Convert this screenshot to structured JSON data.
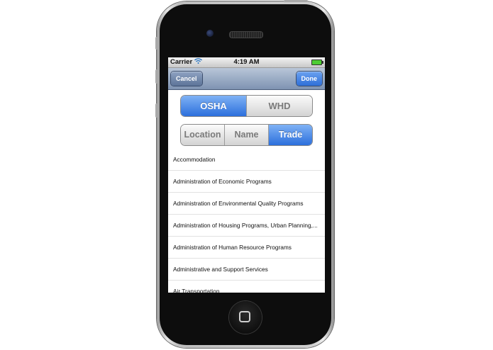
{
  "status_bar": {
    "carrier": "Carrier",
    "time": "4:19 AM"
  },
  "nav_bar": {
    "cancel_label": "Cancel",
    "done_label": "Done"
  },
  "agency_segment": {
    "options": [
      "OSHA",
      "WHD"
    ],
    "selected": "OSHA"
  },
  "search_segment": {
    "options": [
      "Location",
      "Name",
      "Trade"
    ],
    "selected": "Trade"
  },
  "trade_list": [
    "Accommodation",
    "Administration of Economic Programs",
    "Administration of Environmental Quality Programs",
    "Administration of Housing Programs, Urban Planning,...",
    "Administration of Human Resource Programs",
    "Administrative and Support Services",
    "Air Transportation"
  ],
  "icons": {
    "wifi": "wifi-icon",
    "battery": "battery-icon",
    "home": "home-button-icon"
  },
  "colors": {
    "selected_segment": "#2c6fdc",
    "navbar": "#7e93b2",
    "done_button": "#2e6fd8",
    "battery": "#4ccc33"
  }
}
